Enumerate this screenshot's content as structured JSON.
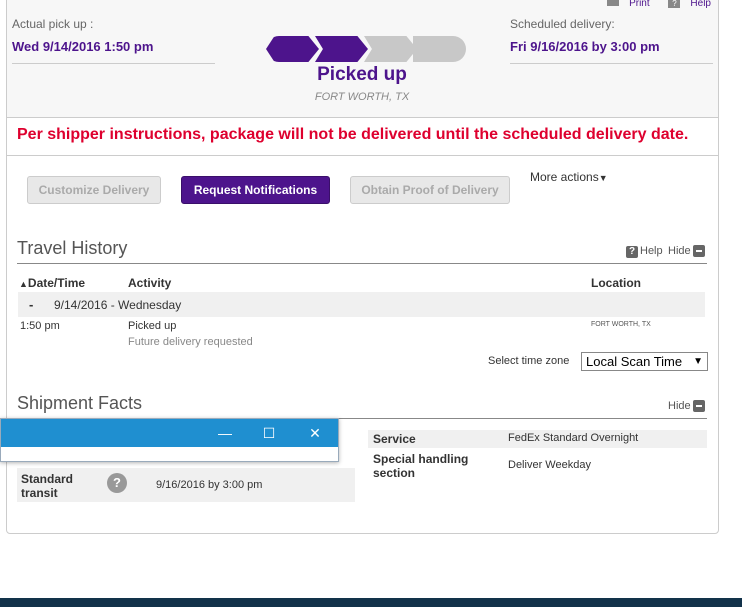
{
  "top_links": {
    "print": "Print",
    "help": "Help"
  },
  "pickup": {
    "label": "Actual pick up :",
    "value": "Wed 9/14/2016 1:50 pm"
  },
  "scheduled": {
    "label": "Scheduled delivery:",
    "value": "Fri 9/16/2016 by 3:00 pm"
  },
  "progress": {
    "completed_steps": 2,
    "total_steps": 4,
    "status": "Picked up",
    "location": "FORT WORTH, TX"
  },
  "warning": "Per shipper instructions, package will not be delivered until the scheduled delivery date.",
  "actions": {
    "customize": "Customize Delivery",
    "notifications": "Request Notifications",
    "proof": "Obtain Proof of Delivery",
    "more": "More actions"
  },
  "travel": {
    "title": "Travel History",
    "help": "Help",
    "hide": "Hide",
    "columns": {
      "date": "Date/Time",
      "activity": "Activity",
      "location": "Location"
    },
    "date_group": {
      "toggle": "-",
      "label": "9/14/2016 - Wednesday"
    },
    "rows": [
      {
        "time": "1:50 pm",
        "activity": "Picked up",
        "detail": "Future delivery requested",
        "location": "FORT WORTH, TX"
      }
    ],
    "timezone_label": "Select time zone",
    "timezone_value": "Local Scan Time"
  },
  "facts": {
    "title": "Shipment Facts",
    "hide": "Hide",
    "left": [
      {
        "label": "Standard transit",
        "value": "9/16/2016 by 3:00 pm"
      }
    ],
    "right": [
      {
        "label": "Service",
        "value": "FedEx Standard Overnight"
      },
      {
        "label": "Special handling section",
        "value": "Deliver Weekday"
      }
    ]
  },
  "window": {
    "minimize": "—",
    "maximize": "☐",
    "close": "✕"
  },
  "colors": {
    "brand_purple": "#4d148c",
    "warning_red": "#de002e",
    "window_blue": "#1f8fd0"
  }
}
